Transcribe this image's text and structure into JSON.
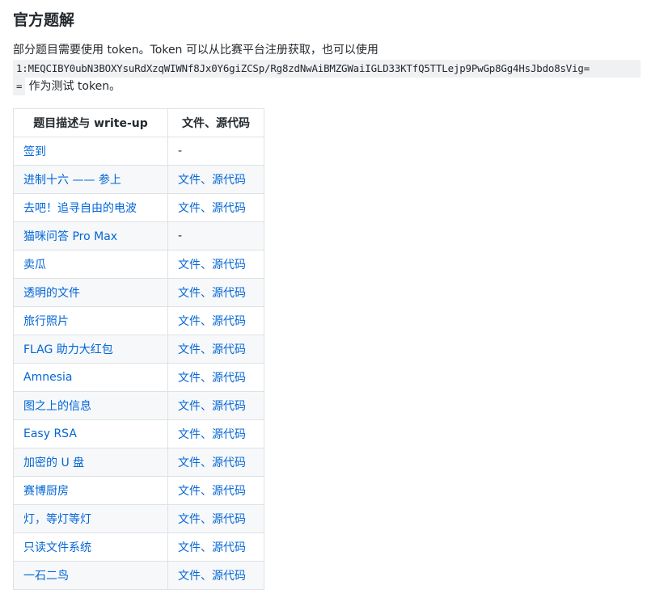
{
  "heading": "官方题解",
  "intro_text": "部分题目需要使用 token。Token 可以从比赛平台注册获取，也可以使用",
  "token": "1:MEQCIBY0ubN3BOXYsuRdXzqWIWNf8Jx0Y6giZCSp/Rg8zdNwAiBMZGWaiIGLD33KTfQ5TTLejp9PwGp8Gg4HsJbdo8sVig=",
  "token_tail": "=",
  "outro_text": "作为测试 token。",
  "table": {
    "headers": [
      "题目描述与 write-up",
      "文件、源代码"
    ],
    "rows": [
      {
        "title": "签到",
        "files": "-"
      },
      {
        "title": "进制十六 —— 参上",
        "files": "文件、源代码"
      },
      {
        "title": "去吧！追寻自由的电波",
        "files": "文件、源代码"
      },
      {
        "title": "猫咪问答 Pro Max",
        "files": "-"
      },
      {
        "title": "卖瓜",
        "files": "文件、源代码"
      },
      {
        "title": "透明的文件",
        "files": "文件、源代码"
      },
      {
        "title": "旅行照片",
        "files": "文件、源代码"
      },
      {
        "title": "FLAG 助力大红包",
        "files": "文件、源代码"
      },
      {
        "title": "Amnesia",
        "files": "文件、源代码"
      },
      {
        "title": "图之上的信息",
        "files": "文件、源代码"
      },
      {
        "title": "Easy RSA",
        "files": "文件、源代码"
      },
      {
        "title": "加密的 U 盘",
        "files": "文件、源代码"
      },
      {
        "title": "赛博厨房",
        "files": "文件、源代码"
      },
      {
        "title": "灯，等灯等灯",
        "files": "文件、源代码"
      },
      {
        "title": "只读文件系统",
        "files": "文件、源代码"
      },
      {
        "title": "一石二鸟",
        "files": "文件、源代码"
      }
    ]
  },
  "colors": {
    "link": "#0366d6",
    "text": "#24292e",
    "code_bg": "#eff1f3",
    "row_alt_bg": "#f6f8fa",
    "border": "#dfe2e5"
  }
}
